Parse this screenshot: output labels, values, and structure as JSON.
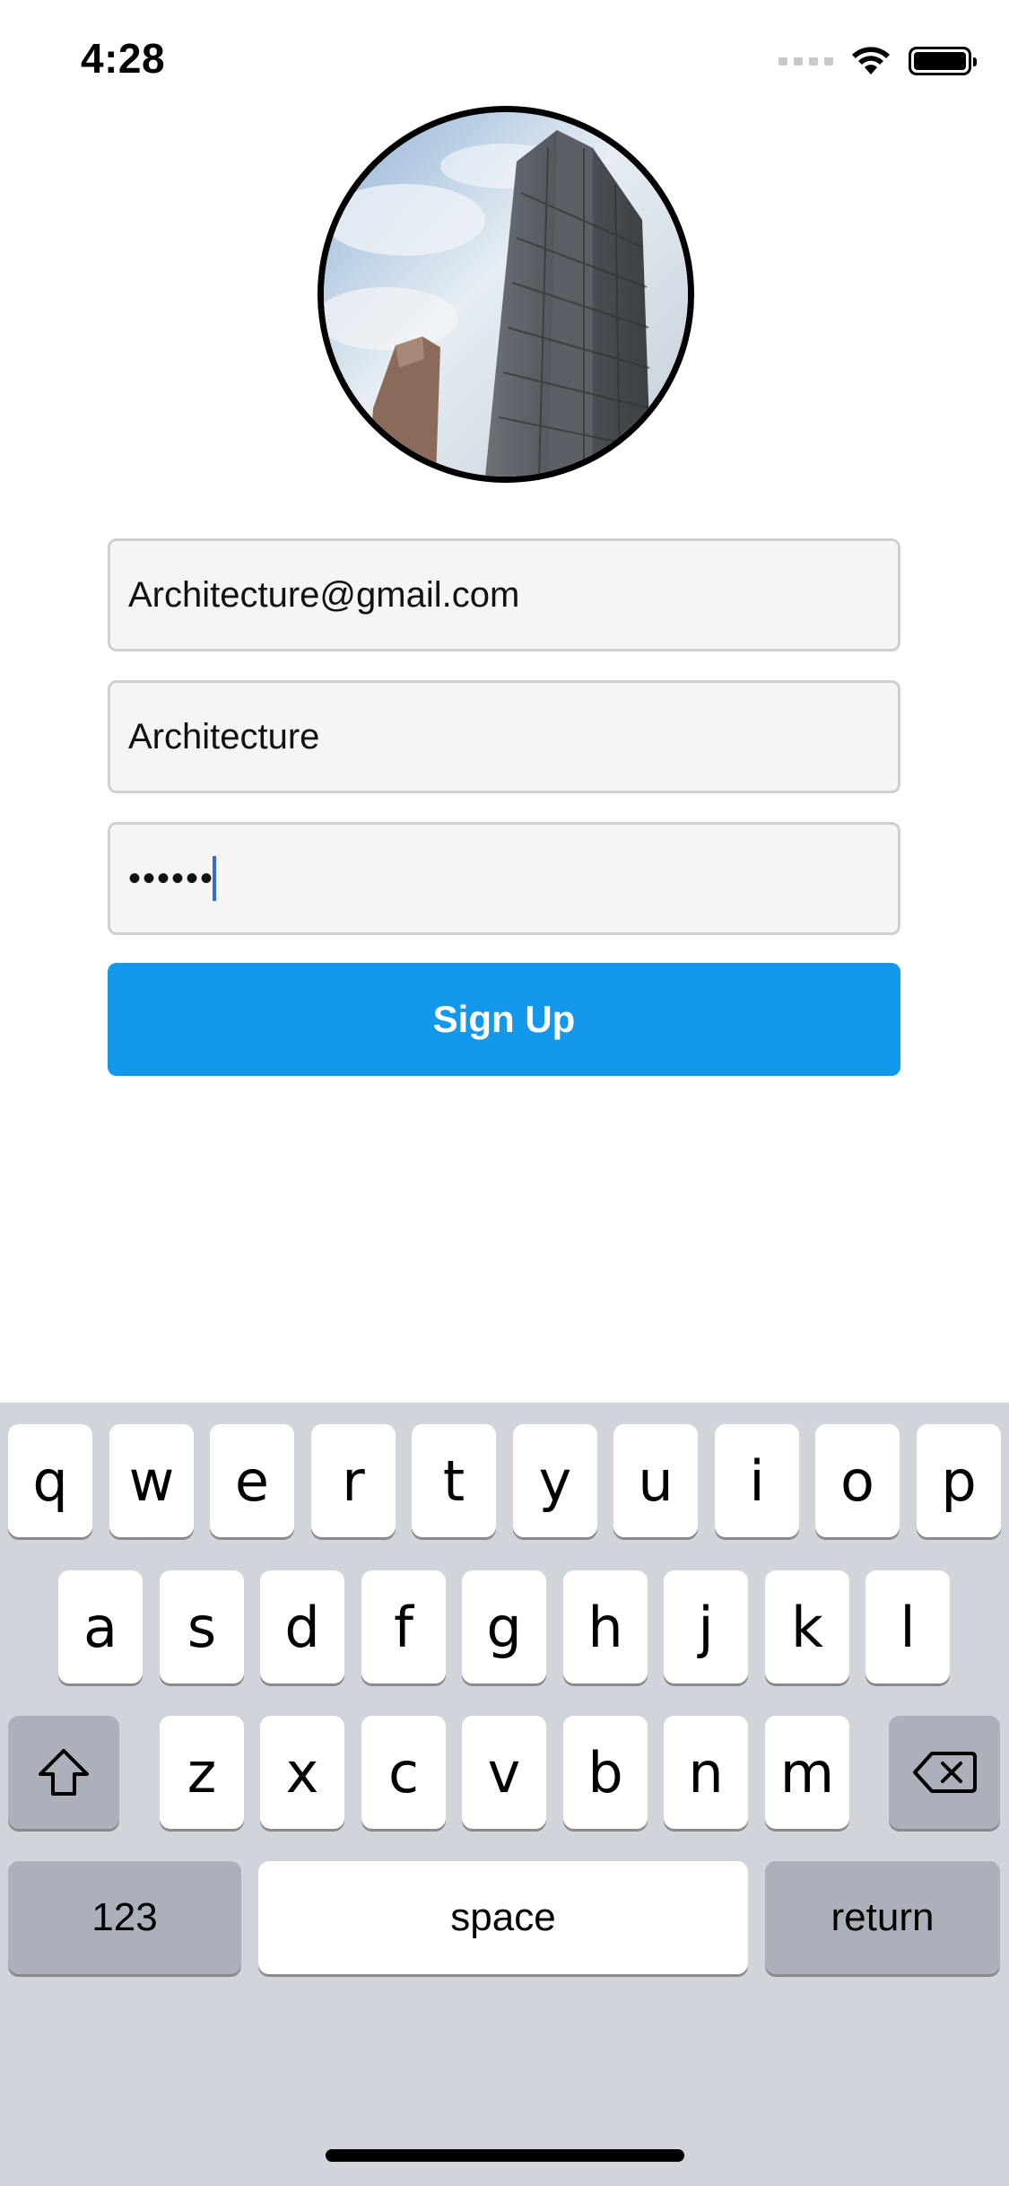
{
  "status_bar": {
    "time": "4:28"
  },
  "form": {
    "email_value": "Architecture@gmail.com",
    "username_value": "Architecture",
    "password_masked": "••••••",
    "signup_label": "Sign Up"
  },
  "keyboard": {
    "row1": [
      "q",
      "w",
      "e",
      "r",
      "t",
      "y",
      "u",
      "i",
      "o",
      "p"
    ],
    "row2": [
      "a",
      "s",
      "d",
      "f",
      "g",
      "h",
      "j",
      "k",
      "l"
    ],
    "row3": [
      "z",
      "x",
      "c",
      "v",
      "b",
      "n",
      "m"
    ],
    "numbers_label": "123",
    "space_label": "space",
    "return_label": "return"
  },
  "colors": {
    "primary_button": "#1498ec",
    "keyboard_bg": "#d1d4da",
    "cursor": "#2f6be6"
  }
}
